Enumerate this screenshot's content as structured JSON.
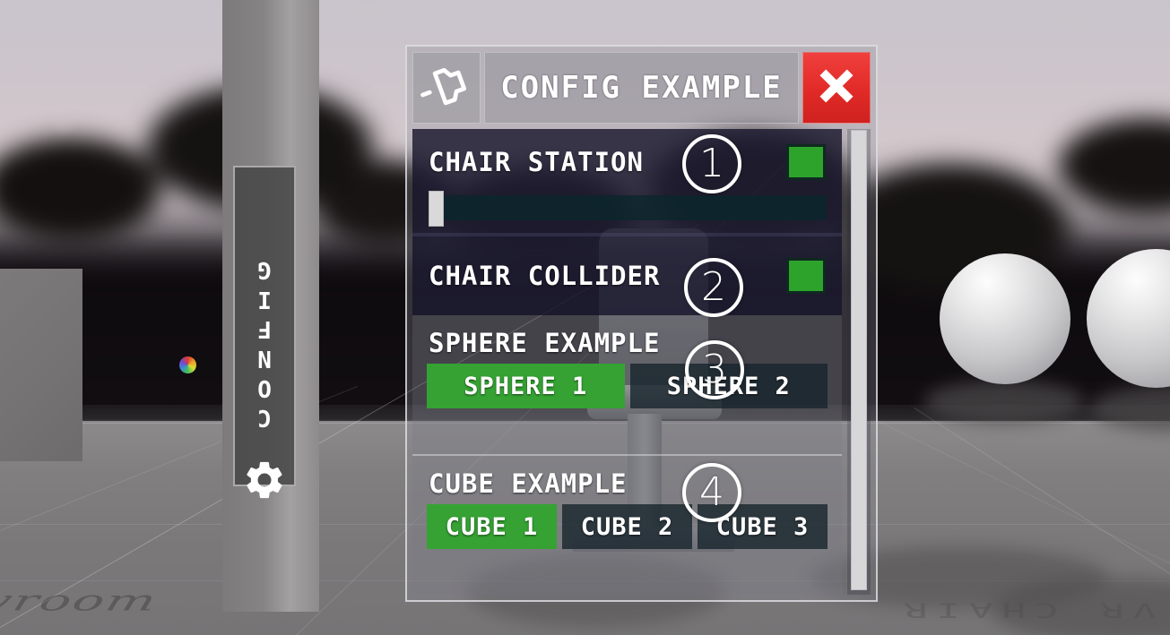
{
  "sidebar": {
    "label": "CONFIG",
    "gear_icon": "gear-icon"
  },
  "panel": {
    "title": "CONFIG EXAMPLE",
    "pin_icon": "pin-icon",
    "close_icon": "close-x-icon",
    "rows": [
      {
        "label": "CHAIR STATION",
        "toggle_on": true,
        "toggle_color": "#2ea32c",
        "has_slider": true,
        "slider_value": 0
      },
      {
        "label": "CHAIR COLLIDER",
        "toggle_on": true,
        "toggle_color": "#2ea32c",
        "has_slider": false
      }
    ],
    "groups": [
      {
        "label": "SPHERE EXAMPLE",
        "options": [
          {
            "label": "SPHERE 1",
            "selected": true
          },
          {
            "label": "SPHERE 2",
            "selected": false
          }
        ]
      },
      {
        "label": "CUBE EXAMPLE",
        "options": [
          {
            "label": "CUBE 1",
            "selected": true
          },
          {
            "label": "CUBE 2",
            "selected": false
          },
          {
            "label": "CUBE 3",
            "selected": false
          }
        ]
      }
    ],
    "scrollbar": {
      "name": "vertical-scrollbar"
    }
  },
  "annotations": [
    {
      "number": "①",
      "digit": "1"
    },
    {
      "number": "②",
      "digit": "2"
    },
    {
      "number": "③",
      "digit": "3"
    },
    {
      "number": "④",
      "digit": "4"
    }
  ],
  "scene": {
    "floor_logo_text": "vroom",
    "floor_sign_text": "VR CHAIR"
  },
  "colors": {
    "accent_green": "#2ea32c",
    "close_red": "#e12a27",
    "panel_dark": "#161429",
    "text_white": "#ffffff"
  }
}
